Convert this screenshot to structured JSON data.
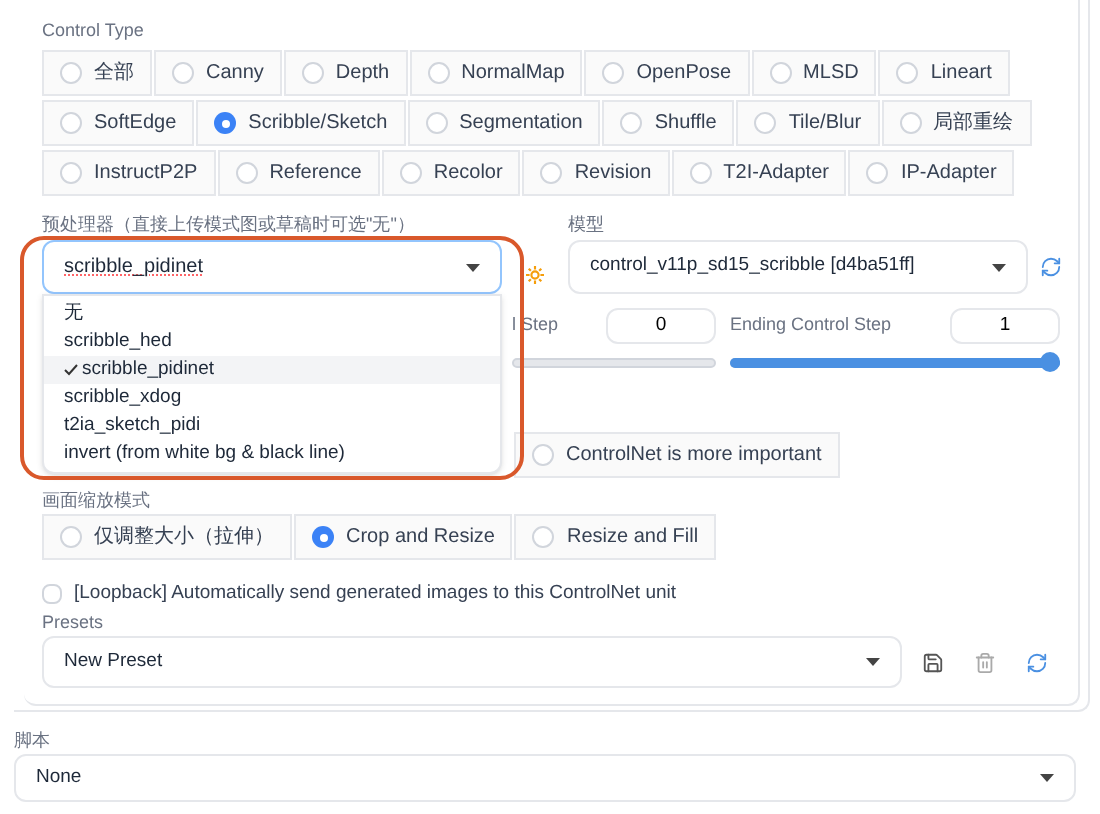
{
  "control_type": {
    "label": "Control Type",
    "options": [
      {
        "label": "全部",
        "selected": false
      },
      {
        "label": "Canny",
        "selected": false
      },
      {
        "label": "Depth",
        "selected": false
      },
      {
        "label": "NormalMap",
        "selected": false
      },
      {
        "label": "OpenPose",
        "selected": false
      },
      {
        "label": "MLSD",
        "selected": false
      },
      {
        "label": "Lineart",
        "selected": false
      },
      {
        "label": "SoftEdge",
        "selected": false
      },
      {
        "label": "Scribble/Sketch",
        "selected": true
      },
      {
        "label": "Segmentation",
        "selected": false
      },
      {
        "label": "Shuffle",
        "selected": false
      },
      {
        "label": "Tile/Blur",
        "selected": false
      },
      {
        "label": "局部重绘",
        "selected": false
      },
      {
        "label": "InstructP2P",
        "selected": false
      },
      {
        "label": "Reference",
        "selected": false
      },
      {
        "label": "Recolor",
        "selected": false
      },
      {
        "label": "Revision",
        "selected": false
      },
      {
        "label": "T2I-Adapter",
        "selected": false
      },
      {
        "label": "IP-Adapter",
        "selected": false
      }
    ]
  },
  "preprocessor": {
    "label": "预处理器（直接上传模式图或草稿时可选\"无\"）",
    "value": "scribble_pidinet",
    "options": [
      {
        "label": "无",
        "selected": false
      },
      {
        "label": "scribble_hed",
        "selected": false
      },
      {
        "label": "scribble_pidinet",
        "selected": true
      },
      {
        "label": "scribble_xdog",
        "selected": false
      },
      {
        "label": "t2ia_sketch_pidi",
        "selected": false
      },
      {
        "label": "invert (from white bg & black line)",
        "selected": false
      }
    ]
  },
  "model": {
    "label": "模型",
    "value": "control_v11p_sd15_scribble [d4ba51ff]"
  },
  "start_step": {
    "label": "l Step",
    "value": "0",
    "level": 0
  },
  "end_step": {
    "label": "Ending Control Step",
    "value": "1",
    "level": 1
  },
  "control_mode": {
    "options": [
      {
        "label": "ControlNet is more important",
        "selected": false
      }
    ]
  },
  "resize_mode": {
    "label": "画面缩放模式",
    "options": [
      {
        "label": "仅调整大小（拉伸）",
        "selected": false
      },
      {
        "label": "Crop and Resize",
        "selected": true
      },
      {
        "label": "Resize and Fill",
        "selected": false
      }
    ]
  },
  "loopback": {
    "label": "[Loopback] Automatically send generated images to this ControlNet unit",
    "checked": false
  },
  "presets": {
    "label": "Presets",
    "value": "New Preset"
  },
  "script": {
    "label": "脚本",
    "value": "None"
  }
}
